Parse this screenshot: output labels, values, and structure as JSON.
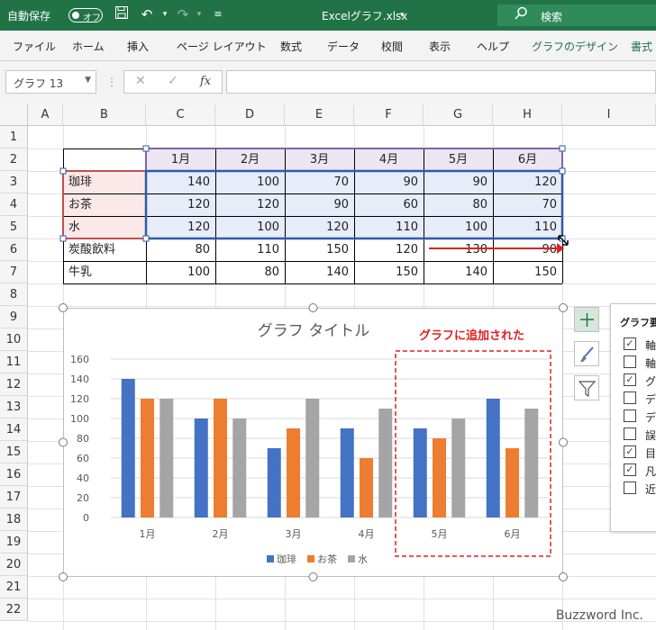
{
  "titlebar": {
    "autosave_label": "自動保存",
    "autosave_state": "オフ",
    "filename": "Excelグラフ.xlsx",
    "search_label": "検索"
  },
  "ribbon": {
    "tabs": [
      "ファイル",
      "ホーム",
      "挿入",
      "ページ レイアウト",
      "数式",
      "データ",
      "校閲",
      "表示",
      "ヘルプ",
      "グラフのデザイン",
      "書式"
    ]
  },
  "formula_bar": {
    "name_box": "グラフ 13",
    "fx": "fx",
    "cancel": "✕",
    "enter": "✓",
    "formula": ""
  },
  "grid": {
    "columns": [
      "A",
      "B",
      "C",
      "D",
      "E",
      "F",
      "G",
      "H",
      "I"
    ],
    "rows": [
      "1",
      "2",
      "3",
      "4",
      "5",
      "6",
      "7",
      "8",
      "9",
      "10",
      "11",
      "12",
      "13",
      "14",
      "15",
      "16",
      "17",
      "18",
      "19",
      "20",
      "21",
      "22"
    ],
    "header_row": [
      "1月",
      "2月",
      "3月",
      "4月",
      "5月",
      "6月"
    ],
    "data": [
      {
        "label": "珈琲",
        "values": [
          "140",
          "100",
          "70",
          "90",
          "90",
          "120"
        ]
      },
      {
        "label": "お茶",
        "values": [
          "120",
          "120",
          "90",
          "60",
          "80",
          "70"
        ]
      },
      {
        "label": "水",
        "values": [
          "120",
          "100",
          "120",
          "110",
          "100",
          "110"
        ]
      },
      {
        "label": "炭酸飲料",
        "values": [
          "80",
          "110",
          "150",
          "120",
          "130",
          "90"
        ]
      },
      {
        "label": "牛乳",
        "values": [
          "100",
          "80",
          "140",
          "150",
          "140",
          "150"
        ]
      }
    ]
  },
  "chart_data": {
    "type": "bar",
    "title": "グラフ タイトル",
    "categories": [
      "1月",
      "2月",
      "3月",
      "4月",
      "5月",
      "6月"
    ],
    "series": [
      {
        "name": "珈琲",
        "values": [
          140,
          100,
          70,
          90,
          90,
          120
        ],
        "color": "#4472c4"
      },
      {
        "name": "お茶",
        "values": [
          120,
          120,
          90,
          60,
          80,
          70
        ],
        "color": "#ed7d31"
      },
      {
        "name": "水",
        "values": [
          120,
          100,
          120,
          110,
          100,
          110
        ],
        "color": "#a5a5a5"
      }
    ],
    "ylim": [
      0,
      160
    ],
    "yticks": [
      "0",
      "20",
      "40",
      "60",
      "80",
      "100",
      "120",
      "140",
      "160"
    ],
    "grid": true,
    "legend": "bottom"
  },
  "annotation": {
    "label": "グラフに追加された",
    "color": "#e02020"
  },
  "chart_elements_panel": {
    "title": "グラフ要",
    "items": [
      {
        "label": "軸",
        "checked": true
      },
      {
        "label": "軸",
        "checked": false
      },
      {
        "label": "グ",
        "checked": true
      },
      {
        "label": "デ",
        "checked": false
      },
      {
        "label": "デ",
        "checked": false
      },
      {
        "label": "誤",
        "checked": false
      },
      {
        "label": "目",
        "checked": true
      },
      {
        "label": "凡",
        "checked": true
      },
      {
        "label": "近",
        "checked": false
      }
    ]
  },
  "watermark": "Buzzword Inc.",
  "colors": {
    "excel_green": "#217346",
    "series1": "#4472c4",
    "series2": "#ed7d31",
    "series3": "#a5a5a5",
    "selection_red": "#c0504d",
    "selection_purple": "#8064a2",
    "selection_blue": "#2e5ca8"
  }
}
